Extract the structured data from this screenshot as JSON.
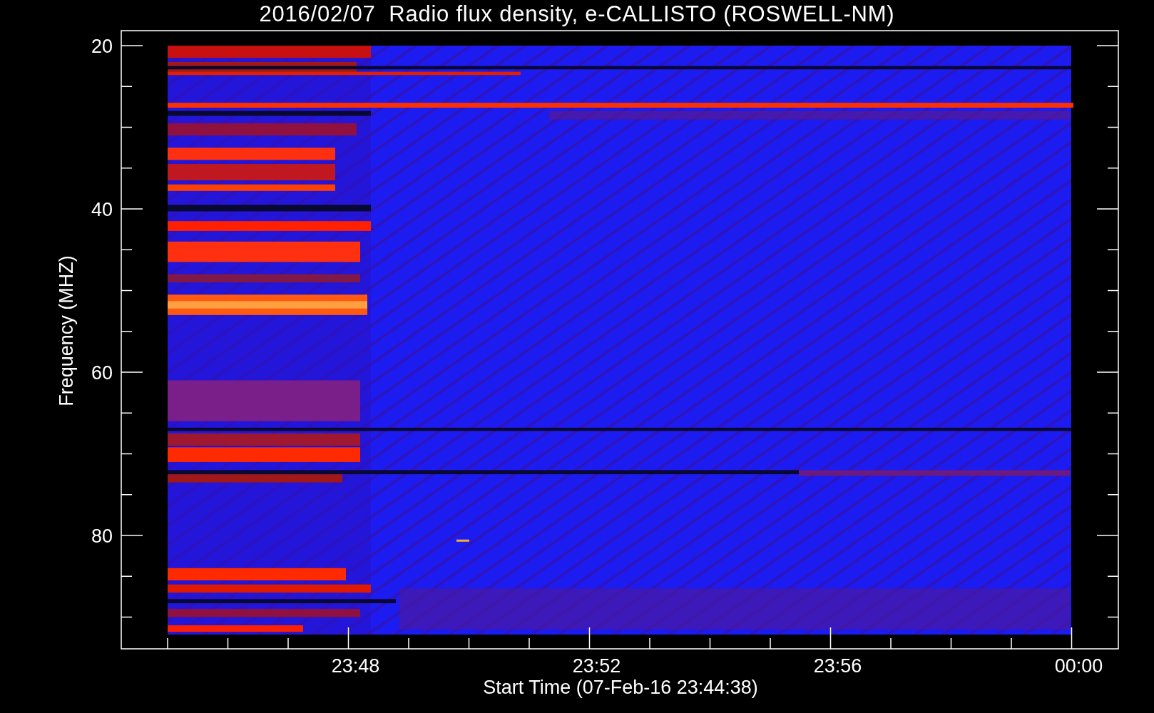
{
  "title": "2016/02/07  Radio flux density, e-CALLISTO (ROSWELL-NM)",
  "plot": {
    "ylabel": "Frequency (MHZ)",
    "xlabel": "Start Time (07-Feb-16 23:44:38)",
    "yticks": [
      "20",
      "40",
      "60",
      "80"
    ],
    "xticks": [
      "23:48",
      "23:52",
      "23:56",
      "00:00"
    ]
  }
}
